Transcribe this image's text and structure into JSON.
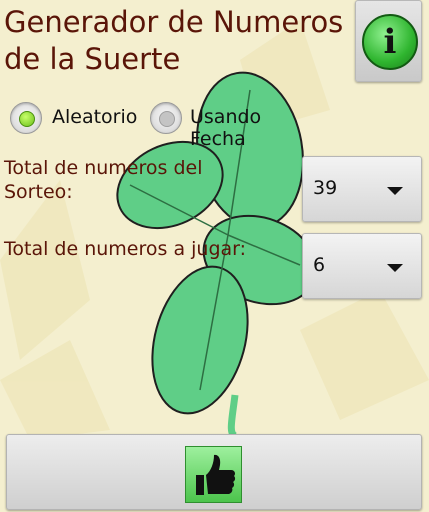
{
  "app": {
    "title": "Generador de Numeros de la Suerte"
  },
  "info_button": {
    "label": "i"
  },
  "mode": {
    "options": [
      {
        "label": "Aleatorio",
        "selected": true
      },
      {
        "label": "Usando Fecha",
        "selected": false
      }
    ]
  },
  "fields": {
    "total_sorteo": {
      "label": "Total de numeros del Sorteo:",
      "value": "39"
    },
    "total_jugar": {
      "label": "Total de numeros a jugar:",
      "value": "6"
    }
  },
  "colors": {
    "title": "#5a1508",
    "clover": "#5fce87",
    "background": "#f4efcf"
  },
  "icons": {
    "info": "info-icon",
    "submit": "thumbs-up-icon",
    "background": "four-leaf-clover-icon"
  }
}
